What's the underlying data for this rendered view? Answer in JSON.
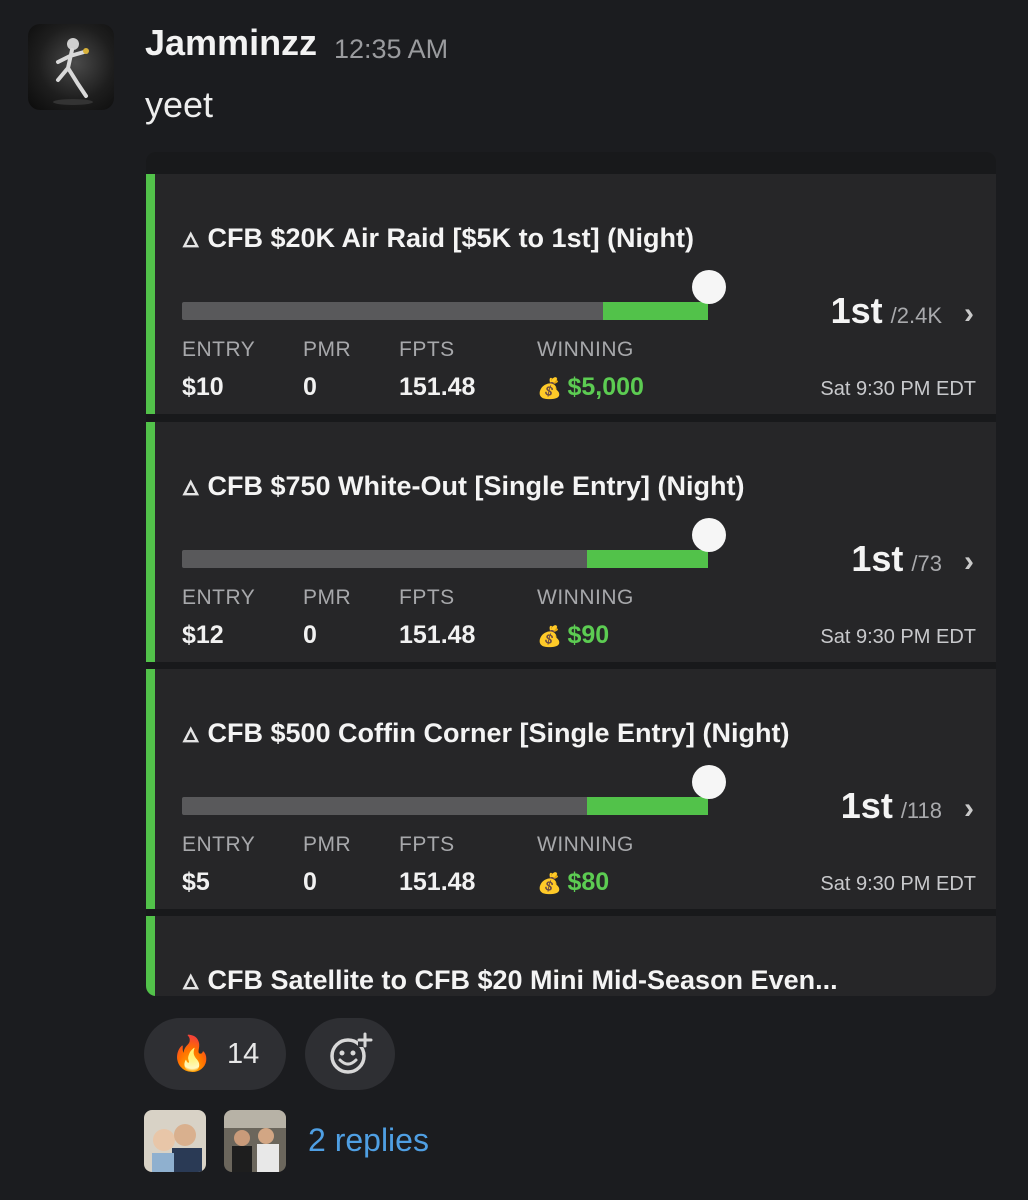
{
  "message": {
    "author": "Jamminzz",
    "time": "12:35 AM",
    "text": "yeet",
    "avatar_icon": "dancer-avatar"
  },
  "labels": {
    "entry": "ENTRY",
    "pmr": "PMR",
    "fpts": "FPTS",
    "winning": "WINNING"
  },
  "contests": [
    {
      "title": "CFB $20K Air Raid [$5K to 1st] (Night)",
      "rank": "1st",
      "of": "/2.4K",
      "progress": 0.2,
      "entry": "$10",
      "pmr": "0",
      "fpts": "151.48",
      "winning": "$5,000",
      "date": "Sat 9:30 PM EDT"
    },
    {
      "title": "CFB $750 White-Out [Single Entry] (Night)",
      "rank": "1st",
      "of": "/73",
      "progress": 0.23,
      "entry": "$12",
      "pmr": "0",
      "fpts": "151.48",
      "winning": "$90",
      "date": "Sat 9:30 PM EDT"
    },
    {
      "title": "CFB $500 Coffin Corner [Single Entry] (Night)",
      "rank": "1st",
      "of": "/118",
      "progress": 0.23,
      "entry": "$5",
      "pmr": "0",
      "fpts": "151.48",
      "winning": "$80",
      "date": "Sat 9:30 PM EDT"
    },
    {
      "title": "CFB Satellite to CFB $20 Mini Mid-Season Even..."
    }
  ],
  "reaction": {
    "emoji": "🔥",
    "count": "14"
  },
  "thread": {
    "replies": "2 replies"
  },
  "colors": {
    "accent_green": "#52c24a",
    "link_blue": "#4f9fe3",
    "background": "#1b1c1f"
  }
}
